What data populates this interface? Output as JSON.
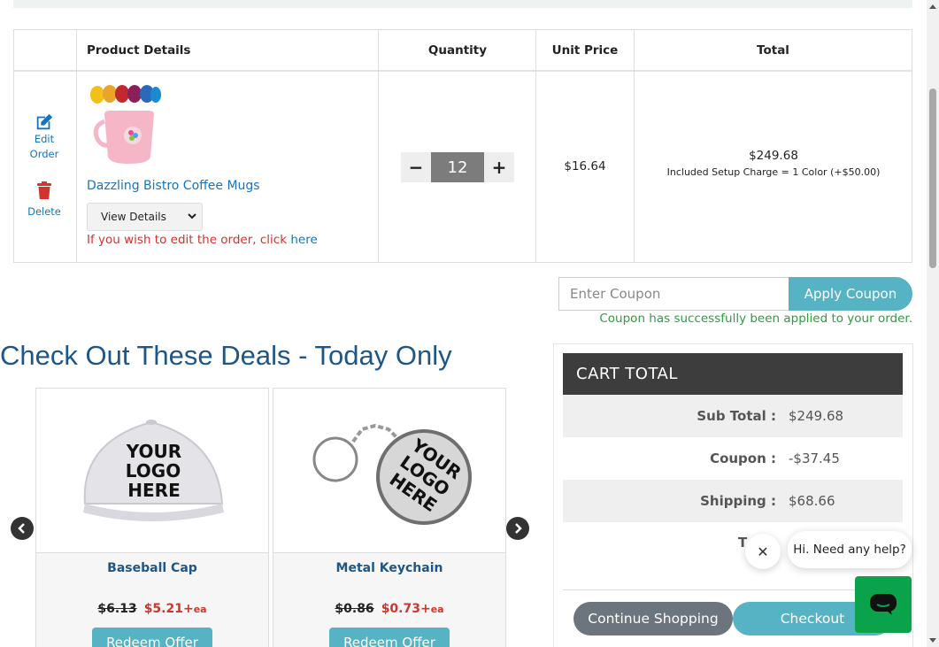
{
  "cart": {
    "headers": {
      "product": "Product Details",
      "quantity": "Quantity",
      "unit_price": "Unit Price",
      "total": "Total"
    },
    "actions": {
      "edit": "Edit",
      "edit2": "Order",
      "delete": "Delete"
    },
    "item": {
      "name": "Dazzling Bistro Coffee Mugs",
      "view_details": "View Details",
      "edit_note": "If you wish to edit the order, click ",
      "edit_link": "here",
      "quantity": "12",
      "minus": "−",
      "plus": "+",
      "unit_price": "$16.64",
      "total": "$249.68",
      "setup": "Included Setup Charge = 1 Color (+$50.00)"
    }
  },
  "coupon": {
    "placeholder": "Enter Coupon",
    "button": "Apply Coupon",
    "message": "Coupon has successfully been applied to your order."
  },
  "deals": {
    "title": "Check Out These Deals - Today Only",
    "items": [
      {
        "name": "Baseball Cap",
        "old_price": "$6.13",
        "new_price": "$5.21+",
        "unit": "ea",
        "button": "Redeem Offer",
        "logo": [
          "YOUR",
          "LOGO",
          "HERE"
        ]
      },
      {
        "name": "Metal Keychain",
        "old_price": "$0.86",
        "new_price": "$0.73+",
        "unit": "ea",
        "button": "Redeem Offer",
        "logo": [
          "YOUR",
          "LOGO",
          "HERE"
        ]
      }
    ]
  },
  "cart_total": {
    "title": "CART  TOTAL",
    "rows": [
      {
        "label": "Sub Total :",
        "value": "$249.68"
      },
      {
        "label": "Coupon :",
        "value": "-$37.45"
      },
      {
        "label": "Shipping :",
        "value": "$68.66"
      }
    ],
    "partial_label": "T",
    "continue": "Continue Shopping",
    "checkout": "Checkout"
  },
  "chat": {
    "greeting": "Hi. Need any help?",
    "close": "✕"
  },
  "colors": {
    "accent": "#55b3c3",
    "link": "#1a73b8",
    "success": "#2e9c42",
    "danger": "#d0342c",
    "heading": "#1f5685",
    "chat": "#0aa34b"
  }
}
